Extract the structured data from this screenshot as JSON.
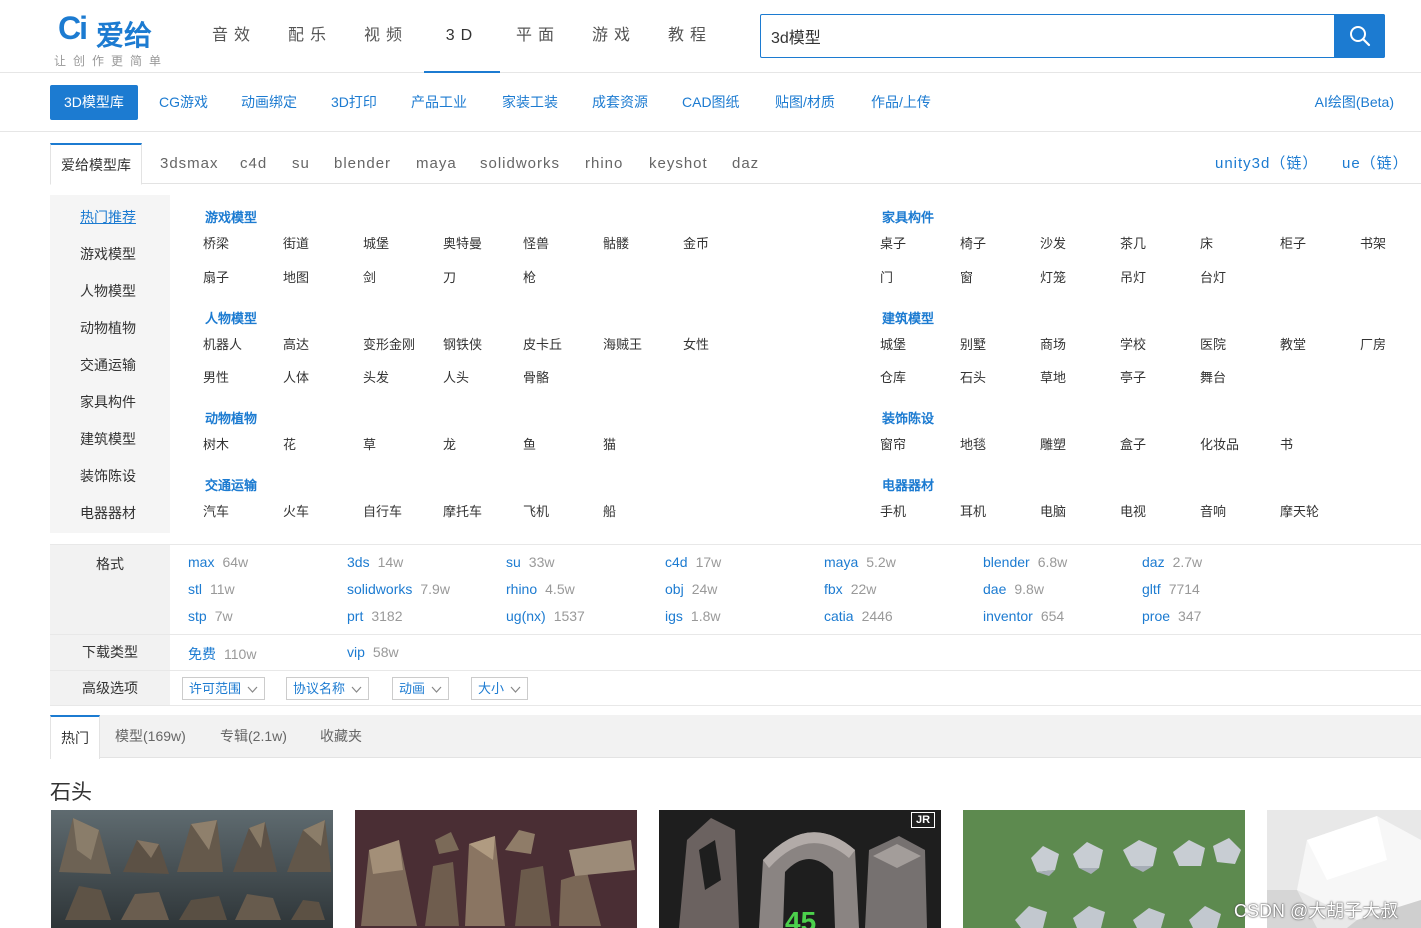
{
  "header": {
    "logo_mark": "Ci",
    "logo_name": "爱给",
    "slogan": "让创作更简单",
    "nav": [
      "音效",
      "配乐",
      "视频",
      "3D",
      "平面",
      "游戏",
      "教程"
    ],
    "nav_active": "3D",
    "search_value": "3d模型"
  },
  "category_nav": {
    "items": [
      "3D模型库",
      "CG游戏",
      "动画绑定",
      "3D打印",
      "产品工业",
      "家装工装",
      "成套资源",
      "CAD图纸",
      "贴图/材质",
      "作品/上传"
    ],
    "right": "AI绘图(Beta)"
  },
  "software_tabs": {
    "items": [
      "爱给模型库",
      "3dsmax",
      "c4d",
      "su",
      "blender",
      "maya",
      "solidworks",
      "rhino",
      "keyshot",
      "daz"
    ],
    "links": [
      "unity3d（链）",
      "ue（链）"
    ]
  },
  "hot": {
    "side": [
      "热门推荐",
      "游戏模型",
      "人物模型",
      "动物植物",
      "交通运输",
      "家具构件",
      "建筑模型",
      "装饰陈设",
      "电器器材"
    ],
    "left_groups": [
      {
        "title": "游戏模型",
        "rows": [
          [
            "桥梁",
            "街道",
            "城堡",
            "奥特曼",
            "怪兽",
            "骷髅",
            "金币"
          ],
          [
            "扇子",
            "地图",
            "剑",
            "刀",
            "枪"
          ]
        ]
      },
      {
        "title": "人物模型",
        "rows": [
          [
            "机器人",
            "高达",
            "变形金刚",
            "钢铁侠",
            "皮卡丘",
            "海贼王",
            "女性"
          ],
          [
            "男性",
            "人体",
            "头发",
            "人头",
            "骨骼"
          ]
        ]
      },
      {
        "title": "动物植物",
        "rows": [
          [
            "树木",
            "花",
            "草",
            "龙",
            "鱼",
            "猫"
          ]
        ]
      },
      {
        "title": "交通运输",
        "rows": [
          [
            "汽车",
            "火车",
            "自行车",
            "摩托车",
            "飞机",
            "船"
          ]
        ]
      }
    ],
    "right_groups": [
      {
        "title": "家具构件",
        "rows": [
          [
            "桌子",
            "椅子",
            "沙发",
            "茶几",
            "床",
            "柜子",
            "书架"
          ],
          [
            "门",
            "窗",
            "灯笼",
            "吊灯",
            "台灯"
          ]
        ]
      },
      {
        "title": "建筑模型",
        "rows": [
          [
            "城堡",
            "别墅",
            "商场",
            "学校",
            "医院",
            "教堂",
            "厂房"
          ],
          [
            "仓库",
            "石头",
            "草地",
            "亭子",
            "舞台"
          ]
        ]
      },
      {
        "title": "装饰陈设",
        "rows": [
          [
            "窗帘",
            "地毯",
            "雕塑",
            "盒子",
            "化妆品",
            "书"
          ]
        ]
      },
      {
        "title": "电器器材",
        "rows": [
          [
            "手机",
            "耳机",
            "电脑",
            "电视",
            "音响",
            "摩天轮"
          ]
        ]
      }
    ]
  },
  "formats": {
    "label": "格式",
    "rows": [
      [
        {
          "name": "max",
          "count": "64w"
        },
        {
          "name": "3ds",
          "count": "14w"
        },
        {
          "name": "su",
          "count": "33w"
        },
        {
          "name": "c4d",
          "count": "17w"
        },
        {
          "name": "maya",
          "count": "5.2w"
        },
        {
          "name": "blender",
          "count": "6.8w"
        },
        {
          "name": "daz",
          "count": "2.7w"
        }
      ],
      [
        {
          "name": "stl",
          "count": "11w"
        },
        {
          "name": "solidworks",
          "count": "7.9w"
        },
        {
          "name": "rhino",
          "count": "4.5w"
        },
        {
          "name": "obj",
          "count": "24w"
        },
        {
          "name": "fbx",
          "count": "22w"
        },
        {
          "name": "dae",
          "count": "9.8w"
        },
        {
          "name": "gltf",
          "count": "7714"
        }
      ],
      [
        {
          "name": "stp",
          "count": "7w"
        },
        {
          "name": "prt",
          "count": "3182"
        },
        {
          "name": "ug(nx)",
          "count": "1537"
        },
        {
          "name": "igs",
          "count": "1.8w"
        },
        {
          "name": "catia",
          "count": "2446"
        },
        {
          "name": "inventor",
          "count": "654"
        },
        {
          "name": "proe",
          "count": "347"
        }
      ]
    ]
  },
  "download": {
    "label": "下载类型",
    "items": [
      {
        "name": "免费",
        "count": "110w"
      },
      {
        "name": "vip",
        "count": "58w"
      }
    ]
  },
  "advanced": {
    "label": "高级选项",
    "options": [
      "许可范围",
      "协议名称",
      "动画",
      "大小"
    ]
  },
  "result_tabs": [
    "热门",
    "模型(169w)",
    "专辑(2.1w)",
    "收藏夹"
  ],
  "section_title": "石头",
  "thumbnails": [
    {
      "name": "rock-set-dark"
    },
    {
      "name": "rock-set-purple"
    },
    {
      "name": "rock-arch",
      "badge": "45",
      "logo": "JR"
    },
    {
      "name": "rock-set-green"
    },
    {
      "name": "rock-white"
    }
  ],
  "watermark": "CSDN @大胡子大叔",
  "colors": {
    "accent": "#1c7bd1",
    "side_bg": "#f5f5f5",
    "row_label_bg": "#f2f2f2"
  }
}
